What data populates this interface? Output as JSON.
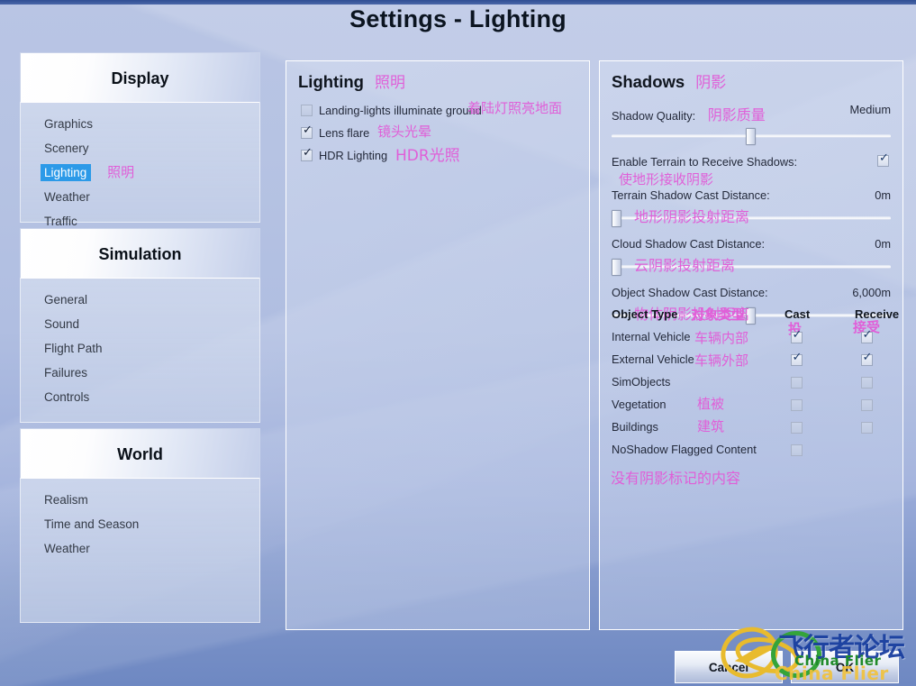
{
  "window": {
    "title": "Settings - Lighting"
  },
  "colors": {
    "annotation": "#e05fd8",
    "selected_nav": "#2c9ae8",
    "background_top": "#b9c5e4",
    "background_bottom": "#6e88c2",
    "watermark_blue": "#1a3fa0",
    "watermark_green": "#1f8a2a",
    "watermark_yellow": "#e8bb2e"
  },
  "sidebar": {
    "groups": [
      {
        "header": "Display",
        "items": [
          {
            "label": "Graphics",
            "cn": "",
            "selected": false
          },
          {
            "label": "Scenery",
            "cn": "",
            "selected": false
          },
          {
            "label": "Lighting",
            "cn": "照明",
            "selected": true
          },
          {
            "label": "Weather",
            "cn": "",
            "selected": false
          },
          {
            "label": "Traffic",
            "cn": "",
            "selected": false
          }
        ]
      },
      {
        "header": "Simulation",
        "items": [
          {
            "label": "General",
            "cn": "",
            "selected": false
          },
          {
            "label": "Sound",
            "cn": "",
            "selected": false
          },
          {
            "label": "Flight Path",
            "cn": "",
            "selected": false
          },
          {
            "label": "Failures",
            "cn": "",
            "selected": false
          },
          {
            "label": "Controls",
            "cn": "",
            "selected": false
          }
        ]
      },
      {
        "header": "World",
        "items": [
          {
            "label": "Realism",
            "cn": "",
            "selected": false
          },
          {
            "label": "Time and Season",
            "cn": "",
            "selected": false
          },
          {
            "label": "Weather",
            "cn": "",
            "selected": false
          }
        ]
      }
    ]
  },
  "lighting_panel": {
    "title": "Lighting",
    "title_cn": "照明",
    "options": [
      {
        "label": "Landing-lights illuminate ground",
        "cn": "着陆灯照亮地面",
        "checked": false
      },
      {
        "label": "Lens flare",
        "cn": "镜头光晕",
        "checked": true
      },
      {
        "label": "HDR Lighting",
        "cn": "HDR光照",
        "checked": true
      }
    ]
  },
  "shadows_panel": {
    "title": "Shadows",
    "title_cn": "阴影",
    "shadow_quality": {
      "label": "Shadow Quality:",
      "cn": "阴影质量",
      "value": "Medium",
      "slider_percent": 50
    },
    "enable_terrain_receive": {
      "label": "Enable Terrain to Receive Shadows:",
      "cn": "使地形接收阴影",
      "checked": true
    },
    "terrain_shadow_cast": {
      "label": "Terrain Shadow Cast Distance:",
      "cn": "地形阴影投射距离",
      "value": "0m",
      "slider_percent": 0
    },
    "cloud_shadow_cast": {
      "label": "Cloud Shadow Cast Distance:",
      "cn": "云阴影投射距离",
      "value": "0m",
      "slider_percent": 0
    },
    "object_shadow_cast": {
      "label": "Object Shadow Cast Distance:",
      "cn": "物体阴影投射距离",
      "value": "6,000m",
      "slider_percent": 50
    },
    "table": {
      "col_type": "Object Type",
      "col_type_cn": "对象类型",
      "col_cast": "Cast",
      "col_cast_cn": "投",
      "col_receive": "Receive",
      "col_receive_cn": "接受",
      "rows": [
        {
          "name": "Internal Vehicle",
          "cn": "车辆内部",
          "cast": true,
          "receive": true,
          "has_receive": true
        },
        {
          "name": "External Vehicle",
          "cn": "车辆外部",
          "cast": true,
          "receive": true,
          "has_receive": true
        },
        {
          "name": "SimObjects",
          "cn": "",
          "cast": false,
          "receive": false,
          "has_receive": true
        },
        {
          "name": "Vegetation",
          "cn": "植被",
          "cast": false,
          "receive": false,
          "has_receive": true
        },
        {
          "name": "Buildings",
          "cn": "建筑",
          "cast": false,
          "receive": false,
          "has_receive": true
        },
        {
          "name": "NoShadow Flagged Content",
          "cn": "没有阴影标记的内容",
          "cast": false,
          "receive": false,
          "has_receive": false
        }
      ]
    }
  },
  "buttons": {
    "cancel": "Cancel",
    "ok": "OK"
  },
  "watermark": {
    "cn": "飞行者论坛",
    "en_green": "China Flier",
    "en_yellow": "China Flier"
  }
}
